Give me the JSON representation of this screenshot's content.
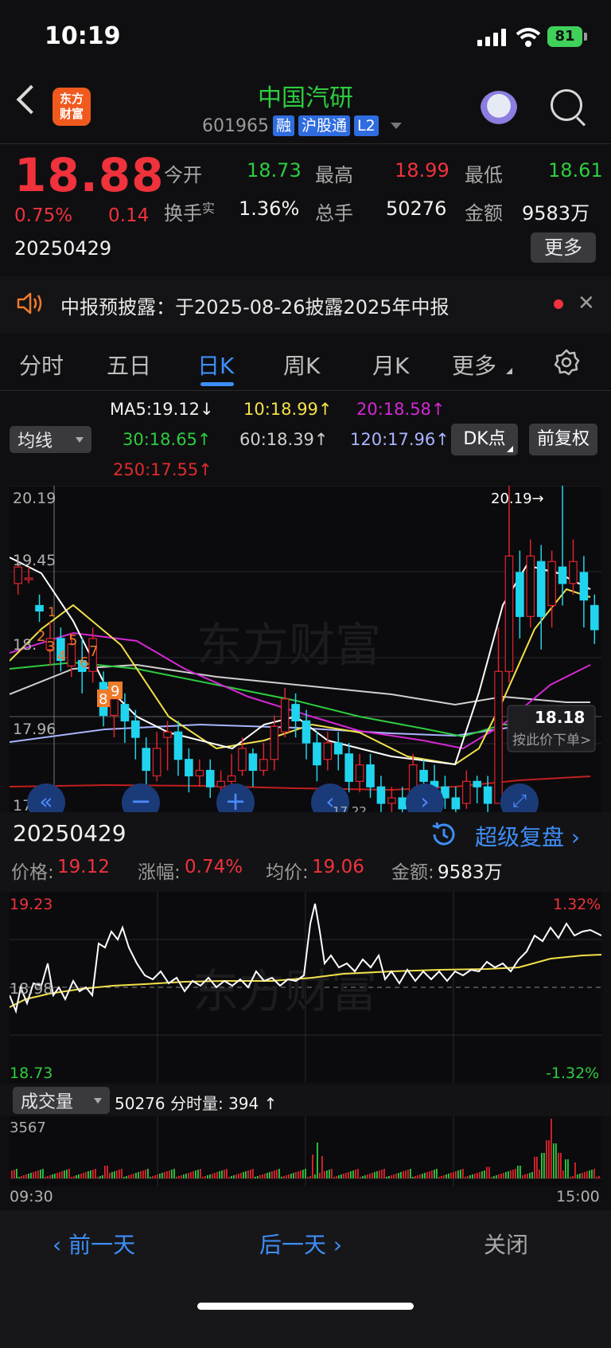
{
  "status": {
    "time": "10:19",
    "battery": "81"
  },
  "header": {
    "name": "中国汽研",
    "code": "601965",
    "tags": [
      "融",
      "沪股通",
      "L2"
    ],
    "logo": "东方\n财富"
  },
  "quote": {
    "price": "18.88",
    "change_pct": "0.75%",
    "change": "0.14",
    "date": "20250429",
    "fields": [
      {
        "label": "今开",
        "value": "18.73",
        "color": "green"
      },
      {
        "label": "最高",
        "value": "18.99",
        "color": "red"
      },
      {
        "label": "最低",
        "value": "18.61",
        "color": "green"
      },
      {
        "label": "换手",
        "label_sup": "实",
        "value": "1.36%",
        "color": "white"
      },
      {
        "label": "总手",
        "value": "50276",
        "color": "white"
      },
      {
        "label": "金额",
        "value": "9583万",
        "color": "white"
      }
    ],
    "more": "更多"
  },
  "notice": {
    "text": "中报预披露：于2025-08-26披露2025年中报"
  },
  "tabs": [
    "分时",
    "五日",
    "日K",
    "周K",
    "月K",
    "更多"
  ],
  "ma": {
    "select": "均线",
    "ma5": "MA5:19.12↓",
    "ma10": "10:18.99↑",
    "ma20": "20:18.58↑",
    "ma30": "30:18.65↑",
    "ma60": "60:18.39↑",
    "ma120": "120:17.96↑",
    "ma250": "250:17.55↑",
    "dk": "DK点",
    "fq": "前复权"
  },
  "kline": {
    "y_top": "20.19",
    "y_mid": "19.45",
    "y_mid2": "18.",
    "y_low": "17.96",
    "y_bottom": "17.22",
    "high_marker": "20.19→",
    "price_tag": "18.18",
    "order_tip": "按此价下单>",
    "watermark": "东方财富",
    "signals": [
      "1",
      "2",
      "3",
      "4",
      "5",
      "6",
      "7",
      "8",
      "9"
    ],
    "chart_data": {
      "type": "candlestick",
      "ylim": [
        17.22,
        20.19
      ],
      "candles": [
        [
          19.3,
          19.45,
          19.55,
          19.2
        ],
        [
          19.35,
          19.35,
          19.45,
          19.3
        ],
        [
          19.1,
          19.05,
          19.2,
          18.95
        ],
        [
          18.7,
          18.8,
          18.95,
          18.55
        ],
        [
          18.8,
          18.6,
          18.9,
          18.5
        ],
        [
          18.55,
          18.75,
          18.85,
          18.45
        ],
        [
          18.6,
          18.5,
          18.8,
          18.3
        ],
        [
          18.5,
          18.8,
          18.9,
          18.4
        ],
        [
          18.4,
          18.1,
          18.5,
          18.0
        ],
        [
          18.1,
          18.25,
          18.35,
          17.9
        ],
        [
          18.2,
          18.05,
          18.3,
          17.85
        ],
        [
          18.05,
          17.9,
          18.15,
          17.7
        ],
        [
          17.8,
          17.6,
          17.9,
          17.4
        ],
        [
          17.55,
          17.8,
          17.95,
          17.5
        ],
        [
          17.9,
          17.95,
          18.05,
          17.6
        ],
        [
          17.95,
          17.7,
          18.05,
          17.55
        ],
        [
          17.7,
          17.55,
          17.8,
          17.4
        ],
        [
          17.55,
          17.6,
          17.7,
          17.45
        ],
        [
          17.6,
          17.45,
          17.7,
          17.35
        ],
        [
          17.45,
          17.5,
          17.6,
          17.35
        ],
        [
          17.5,
          17.55,
          17.75,
          17.45
        ],
        [
          17.6,
          17.8,
          17.9,
          17.55
        ],
        [
          17.75,
          17.6,
          17.8,
          17.45
        ],
        [
          17.6,
          17.7,
          17.85,
          17.55
        ],
        [
          17.7,
          18.0,
          18.1,
          17.6
        ],
        [
          17.95,
          18.25,
          18.35,
          17.9
        ],
        [
          18.2,
          18.05,
          18.3,
          17.9
        ],
        [
          18.05,
          17.85,
          18.15,
          17.7
        ],
        [
          17.85,
          17.65,
          17.95,
          17.5
        ],
        [
          17.7,
          17.85,
          17.95,
          17.6
        ],
        [
          17.85,
          17.75,
          17.95,
          17.6
        ],
        [
          17.75,
          17.5,
          17.85,
          17.4
        ],
        [
          17.5,
          17.65,
          17.75,
          17.4
        ],
        [
          17.65,
          17.45,
          17.75,
          17.35
        ],
        [
          17.45,
          17.3,
          17.55,
          17.2
        ],
        [
          17.3,
          17.35,
          17.45,
          17.2
        ],
        [
          17.35,
          17.25,
          17.45,
          17.15
        ],
        [
          17.3,
          17.65,
          17.75,
          17.25
        ],
        [
          17.6,
          17.5,
          17.7,
          17.35
        ],
        [
          17.5,
          17.45,
          17.65,
          17.3
        ],
        [
          17.45,
          17.35,
          17.55,
          17.25
        ],
        [
          17.35,
          17.25,
          17.45,
          17.2
        ],
        [
          17.3,
          17.5,
          17.6,
          17.25
        ],
        [
          17.5,
          17.45,
          17.55,
          17.3
        ],
        [
          17.45,
          17.3,
          17.55,
          17.2
        ],
        [
          17.3,
          18.5,
          18.9,
          17.3
        ],
        [
          18.5,
          19.55,
          20.19,
          18.4
        ],
        [
          19.4,
          19.0,
          19.6,
          18.8
        ],
        [
          19.0,
          19.55,
          19.7,
          18.9
        ],
        [
          19.5,
          19.0,
          19.65,
          18.7
        ],
        [
          19.1,
          19.5,
          19.6,
          18.9
        ],
        [
          19.45,
          19.3,
          20.19,
          19.1
        ],
        [
          19.3,
          19.5,
          19.7,
          19.2
        ],
        [
          19.4,
          19.15,
          19.55,
          18.9
        ],
        [
          19.1,
          18.88,
          19.2,
          18.75
        ]
      ]
    }
  },
  "controls": {
    "tick_label": "17.22"
  },
  "detail": {
    "date": "20250429",
    "replay": "超级复盘",
    "price_label": "价格:",
    "price": "19.12",
    "chg_label": "涨幅:",
    "chg": "0.74%",
    "avg_label": "均价:",
    "avg": "19.06",
    "amt_label": "金额:",
    "amt": "9583万"
  },
  "intraday": {
    "high": "19.23",
    "mid": "18.98",
    "low": "18.73",
    "high_pct": "1.32%",
    "low_pct": "-1.32%",
    "watermark": "东方财富"
  },
  "volume": {
    "select": "成交量",
    "info": "50276 分时量: 394 ↑",
    "max": "3567",
    "start": "09:30",
    "end": "15:00"
  },
  "bottom": {
    "prev": "前一天",
    "next": "后一天",
    "close": "关闭"
  }
}
